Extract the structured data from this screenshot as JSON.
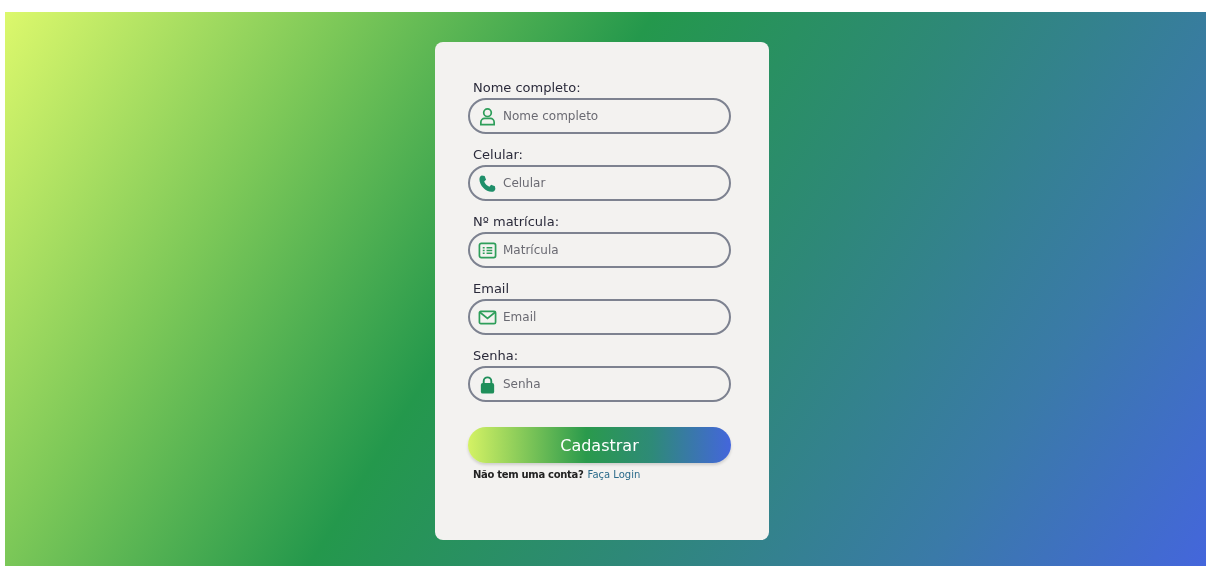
{
  "form": {
    "fields": [
      {
        "label": "Nome completo:",
        "placeholder": "Nome completo",
        "kind": "person"
      },
      {
        "label": "Celular:",
        "placeholder": "Celular",
        "kind": "phone"
      },
      {
        "label": "Nº matrícula:",
        "placeholder": "Matrícula",
        "kind": "list"
      },
      {
        "label": "Email",
        "placeholder": "Email",
        "kind": "mail"
      },
      {
        "label": "Senha:",
        "placeholder": "Senha",
        "kind": "lock"
      }
    ],
    "submit": "Cadastrar",
    "footer": {
      "text": "Não tem uma conta?",
      "link": "Faça Login"
    }
  }
}
